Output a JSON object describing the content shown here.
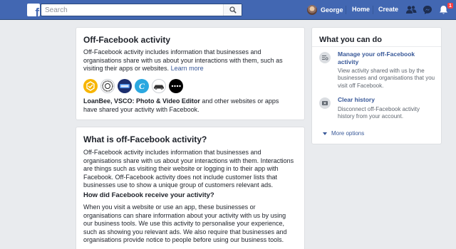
{
  "topbar": {
    "logo_letter": "f",
    "search_placeholder": "Search",
    "user_name": "George",
    "home_label": "Home",
    "create_label": "Create",
    "notification_count": "1",
    "bar_color": "#4267b2"
  },
  "card_ofa": {
    "title": "Off-Facebook activity",
    "body": "Off-Facebook activity includes information that businesses and organisations share with us about your interactions with them, such as visiting their apps or websites.",
    "learn_more": "Learn more",
    "apps": [
      "LoanBee",
      "VSCO",
      "Sky",
      "Canva",
      "Car app",
      "Dots app"
    ],
    "apps_bold": "LoanBee, VSCO: Photo & Video Editor",
    "apps_tail": " and other websites or apps have shared your activity with Facebook."
  },
  "card_what": {
    "title": "What is off-Facebook activity?",
    "body": "Off-Facebook activity includes information that businesses and organisations share with us about your interactions with them. Interactions are things such as visiting their website or logging in to their app with Facebook. Off-Facebook activity does not include customer lists that businesses use to show a unique group of customers relevant ads.",
    "subheading": "How did Facebook receive your activity?",
    "body2": "When you visit a website or use an app, these businesses or organisations can share information about your activity with us by using our business tools. We use this activity to personalise your experience, such as showing you relevant ads. We also require that businesses and organisations provide notice to people before using our business tools."
  },
  "sidebar": {
    "title": "What you can do",
    "items": [
      {
        "label": "Manage your off-Facebook activity",
        "desc": "View activity shared with us by the businesses and organisations that you visit off Facebook.",
        "icon": "list-settings-icon"
      },
      {
        "label": "Clear history",
        "desc": "Disconnect off-Facebook activity history from your account.",
        "icon": "clear-history-icon"
      }
    ],
    "more_options": "More options"
  }
}
